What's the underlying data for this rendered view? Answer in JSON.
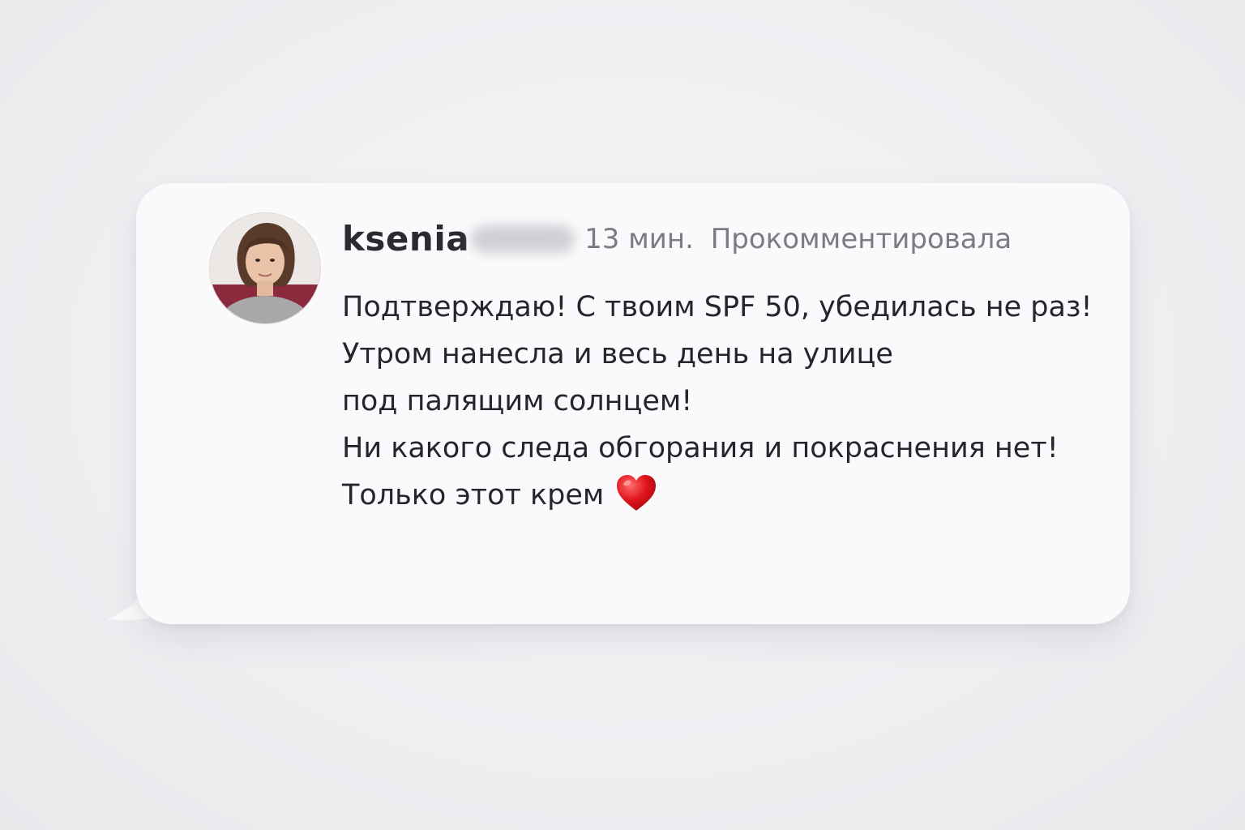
{
  "comment": {
    "username": "ksenia",
    "time": "13 мин.",
    "action": "Прокомментировала",
    "lines": [
      "Подтверждаю! С твоим SPF 50, убедилась не раз!",
      "Утром нанесла и весь день на улице",
      "под палящим солнцем!",
      "Ни какого следа обгорания и покраснения нет!",
      "Только этот крем"
    ],
    "emoji_icon": "heart-icon",
    "heart_color": "#e0141c",
    "bubble_color": "#faf9fb",
    "text_color": "#26252c",
    "meta_color": "#7c7b82"
  }
}
